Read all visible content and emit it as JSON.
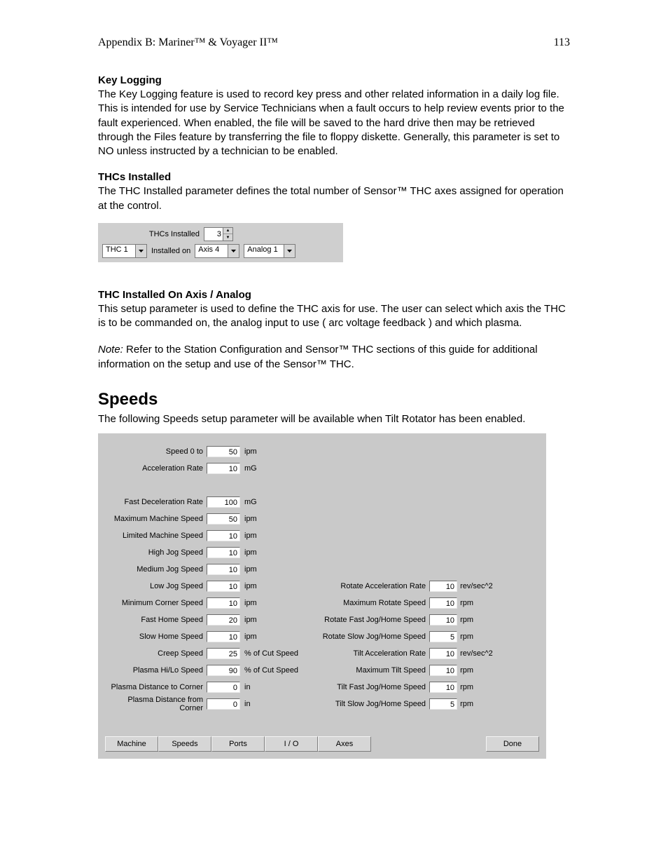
{
  "header": {
    "left": "Appendix B: Mariner™ & Voyager II™",
    "right": "113"
  },
  "key_logging": {
    "title": "Key Logging",
    "body": "The Key Logging feature is used to record key press and other related  information in a daily log  file.  This is intended for use by Service Technicians when a fault occurs to help review events prior to the fault experienced.  When enabled, the file will be saved to the hard drive then may be retrieved through the Files feature by transferring the file to floppy diskette.  Generally, this parameter is set to NO unless instructed by a technician to be enabled."
  },
  "thcs_installed": {
    "title": "THCs Installed",
    "body": "The THC Installed parameter defines the total number of Sensor™ THC axes assigned for operation at the control.",
    "panel": {
      "count_label": "THCs Installed",
      "count_value": "3",
      "thc_select": "THC 1",
      "installed_on_label": "Installed on",
      "axis_select": "Axis 4",
      "analog_select": "Analog 1"
    }
  },
  "thc_axis": {
    "title": "THC Installed On  Axis / Analog",
    "body": "This setup parameter is used to define the THC axis for use.  The user can select which axis the THC is to be commanded on, the analog input to use ( arc voltage feedback ) and which plasma.",
    "note_label": "Note:",
    "note_body": " Refer to the Station Configuration and Sensor™ THC sections of this guide for additional information on the setup and use of the Sensor™ THC."
  },
  "speeds_section": {
    "heading": "Speeds",
    "intro": "The following Speeds setup parameter will be available when Tilt Rotator has been enabled."
  },
  "speeds_left": [
    {
      "label": "Speed 0 to",
      "value": "50",
      "unit": "ipm"
    },
    {
      "label": "Acceleration Rate",
      "value": "10",
      "unit": "mG"
    },
    {
      "gap": true
    },
    {
      "label": "Fast Deceleration Rate",
      "value": "100",
      "unit": "mG"
    },
    {
      "label": "Maximum Machine Speed",
      "value": "50",
      "unit": "ipm"
    },
    {
      "label": "Limited Machine Speed",
      "value": "10",
      "unit": "ipm"
    },
    {
      "label": "High Jog Speed",
      "value": "10",
      "unit": "ipm"
    },
    {
      "label": "Medium Jog Speed",
      "value": "10",
      "unit": "ipm"
    },
    {
      "label": "Low Jog Speed",
      "value": "10",
      "unit": "ipm"
    },
    {
      "label": "Minimum Corner Speed",
      "value": "10",
      "unit": "ipm"
    },
    {
      "label": "Fast Home Speed",
      "value": "20",
      "unit": "ipm"
    },
    {
      "label": "Slow Home Speed",
      "value": "10",
      "unit": "ipm"
    },
    {
      "label": "Creep Speed",
      "value": "25",
      "unit": "% of Cut Speed"
    },
    {
      "label": "Plasma Hi/Lo Speed",
      "value": "90",
      "unit": "% of Cut Speed"
    },
    {
      "label": "Plasma Distance to Corner",
      "value": "0",
      "unit": "in"
    },
    {
      "label": "Plasma Distance from Corner",
      "value": "0",
      "unit": "in"
    }
  ],
  "speeds_right": [
    {
      "label": "Rotate Acceleration Rate",
      "value": "10",
      "unit": "rev/sec^2"
    },
    {
      "label": "Maximum Rotate Speed",
      "value": "10",
      "unit": "rpm"
    },
    {
      "label": "Rotate Fast Jog/Home Speed",
      "value": "10",
      "unit": "rpm"
    },
    {
      "label": "Rotate Slow Jog/Home Speed",
      "value": "5",
      "unit": "rpm"
    },
    {
      "label": "Tilt Acceleration Rate",
      "value": "10",
      "unit": "rev/sec^2"
    },
    {
      "label": "Maximum Tilt Speed",
      "value": "10",
      "unit": "rpm"
    },
    {
      "label": "Tilt Fast Jog/Home Speed",
      "value": "10",
      "unit": "rpm"
    },
    {
      "label": "Tilt Slow Jog/Home Speed",
      "value": "5",
      "unit": "rpm"
    }
  ],
  "buttons": {
    "machine": "Machine",
    "speeds": "Speeds",
    "ports": "Ports",
    "io": "I / O",
    "axes": "Axes",
    "done": "Done"
  }
}
